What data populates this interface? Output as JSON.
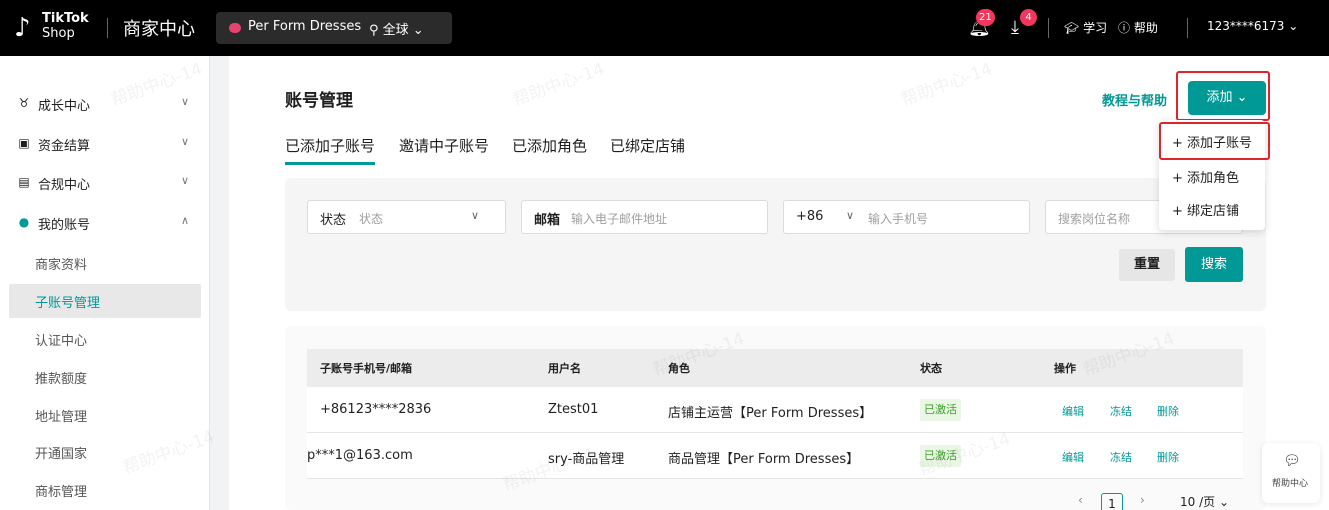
{
  "topbar": {
    "logo_line1": "TikTok",
    "logo_line2": "Shop",
    "app_name": "商家中心",
    "shop_name": "Per Form Dresses",
    "region": "全球",
    "bell_count": "21",
    "download_count": "4",
    "learn": "学习",
    "help": "帮助",
    "account": "123****6173"
  },
  "sidebar": {
    "items": [
      {
        "label": "成长中心",
        "icon": "trophy-icon"
      },
      {
        "label": "资金结算",
        "icon": "wallet-icon"
      },
      {
        "label": "合规中心",
        "icon": "document-icon"
      },
      {
        "label": "我的账号",
        "icon": "user-icon"
      }
    ],
    "sub_items": [
      "商家资料",
      "子账号管理",
      "认证中心",
      "推款额度",
      "地址管理",
      "开通国家",
      "商标管理"
    ],
    "active_sub": "子账号管理"
  },
  "main": {
    "title": "账号管理",
    "tabs": [
      "已添加子账号",
      "邀请中子账号",
      "已添加角色",
      "已绑定店铺"
    ],
    "help_link": "教程与帮助",
    "add_button": "添加",
    "dropdown": [
      "+ 添加子账号",
      "+ 添加角色",
      "+ 绑定店铺"
    ]
  },
  "filters": {
    "status_label": "状态",
    "status_placeholder": "状态",
    "email_label": "邮箱",
    "email_placeholder": "输入电子邮件地址",
    "phone_code": "+86",
    "phone_placeholder": "输入手机号",
    "position_placeholder": "搜索岗位名称",
    "reset": "重置",
    "search": "搜索"
  },
  "table": {
    "headers": [
      "子账号手机号/邮箱",
      "用户名",
      "角色",
      "状态",
      "操作"
    ],
    "rows": [
      {
        "contact": "+86123****2836",
        "username": "Ztest01",
        "role": "店铺主运营【Per Form Dresses】",
        "status": "已激活"
      },
      {
        "contact": "p***1@163.com",
        "username": "sry-商品管理",
        "role": "商品管理【Per Form Dresses】",
        "status": "已激活"
      }
    ],
    "actions": [
      "编辑",
      "冻结",
      "删除"
    ]
  },
  "pagination": {
    "page": "1",
    "page_size": "10 /页"
  },
  "float_help": {
    "label": "帮助中心"
  },
  "watermark": "帮助中心-14",
  "colors": {
    "accent": "#009995",
    "highlight": "#e0242d"
  }
}
